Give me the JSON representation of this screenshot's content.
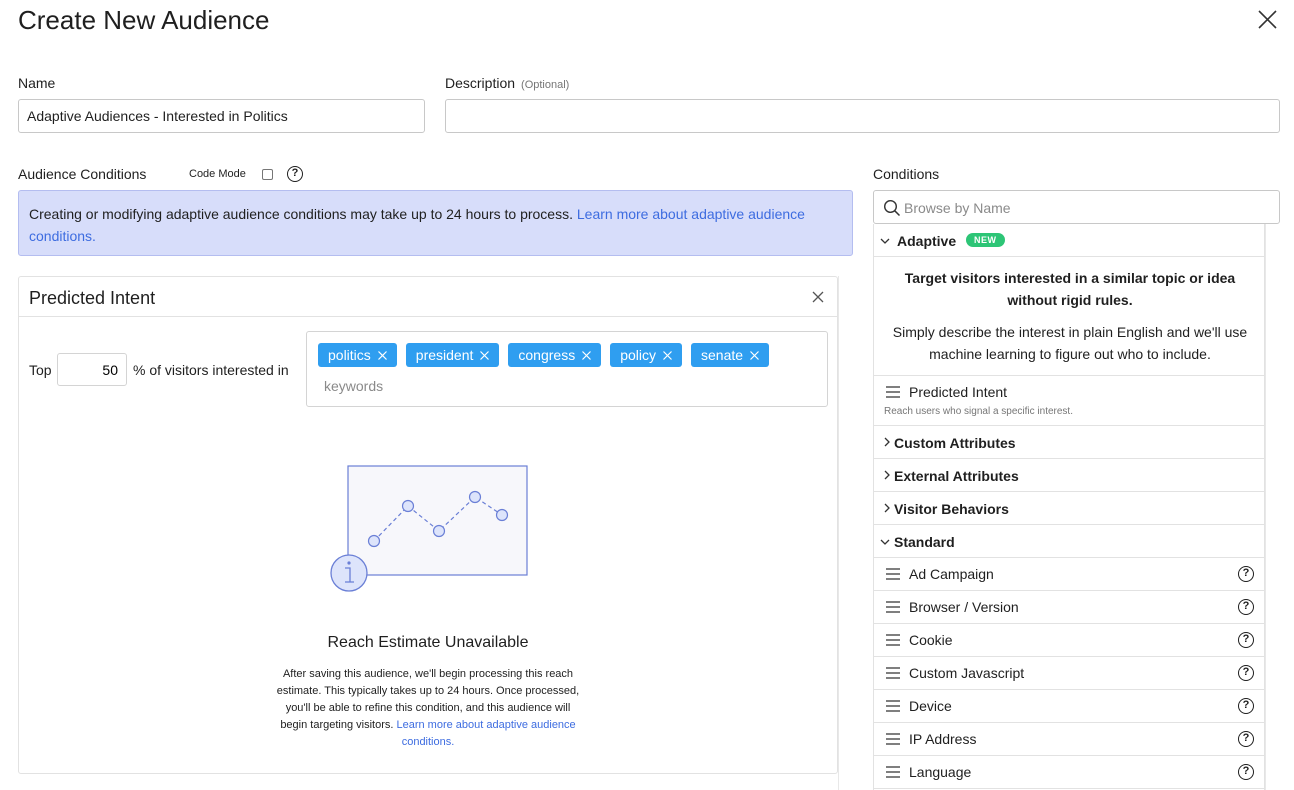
{
  "page": {
    "title": "Create New Audience"
  },
  "form": {
    "name_label": "Name",
    "name_value": "Adaptive Audiences - Interested in Politics",
    "description_label": "Description",
    "description_optional": "(Optional)",
    "description_value": ""
  },
  "audience_conditions": {
    "label": "Audience Conditions",
    "code_mode_label": "Code Mode",
    "code_mode_checked": false,
    "help_icon": "question-circle-icon"
  },
  "banner": {
    "text": "Creating or modifying adaptive audience conditions may take up to 24 hours to process. ",
    "link": "Learn more about adaptive audience conditions.",
    "color": "#d7ddfa"
  },
  "predicted_intent": {
    "title": "Predicted Intent",
    "top_label": "Top",
    "top_value": "50",
    "pct_text": "% of visitors interested in",
    "tags": [
      "politics",
      "president",
      "congress",
      "policy",
      "senate"
    ],
    "keywords_placeholder": "keywords",
    "tag_color": "#2f9ef0",
    "reach_title": "Reach Estimate Unavailable",
    "reach_text": "After saving this audience, we'll begin processing this reach estimate. This typically takes up to 24 hours. Once processed, you'll be able to refine this condition, and this audience will begin targeting visitors. ",
    "reach_link": "Learn more about adaptive audience conditions."
  },
  "conditions": {
    "label": "Conditions",
    "search_placeholder": "Browse by Name",
    "adaptive": {
      "label": "Adaptive",
      "badge": "NEW",
      "badge_color": "#2dc576",
      "desc_bold": "Target visitors interested in a similar topic or idea without rigid rules.",
      "desc": "Simply describe the interest in plain English and we'll use machine learning to figure out who to include."
    },
    "predicted_intent_item": {
      "label": "Predicted Intent",
      "sub": "Reach users who signal a specific interest."
    },
    "groups": [
      "Custom Attributes",
      "External Attributes",
      "Visitor Behaviors"
    ],
    "standard_label": "Standard",
    "standard_items": [
      "Ad Campaign",
      "Browser / Version",
      "Cookie",
      "Custom Javascript",
      "Device",
      "IP Address",
      "Language"
    ]
  }
}
